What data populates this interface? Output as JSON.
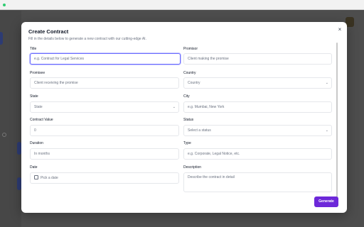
{
  "modal": {
    "title": "Create Contract",
    "subtitle": "Fill in the details below to generate a new contract with our cutting-edge AI.",
    "close_icon": "×",
    "generate_label": "Generate"
  },
  "form": {
    "title": {
      "label": "Title",
      "placeholder": "e.g. Contract for Legal Services"
    },
    "promisor": {
      "label": "Promisor",
      "placeholder": "Client making the promise"
    },
    "promisee": {
      "label": "Promisee",
      "placeholder": "Client receiving the promise"
    },
    "country": {
      "label": "Country",
      "selected": "Country"
    },
    "state": {
      "label": "State",
      "selected": "State"
    },
    "city": {
      "label": "City",
      "placeholder": "e.g. Mumbai, New York"
    },
    "contract_value": {
      "label": "Contract Value",
      "placeholder": "0"
    },
    "status": {
      "label": "Status",
      "selected": "Select a status"
    },
    "duration": {
      "label": "Duration",
      "placeholder": "In months"
    },
    "type": {
      "label": "Type",
      "placeholder": "e.g. Corporate, Legal Notice, etc."
    },
    "date": {
      "label": "Date",
      "placeholder": "Pick a date"
    },
    "description": {
      "label": "Description",
      "placeholder": "Describe the contract in detail"
    }
  },
  "icons": {
    "chevron": "chevron-down-icon",
    "calendar": "calendar-icon",
    "close": "close-icon"
  },
  "colors": {
    "accent": "#6d28d9",
    "focus_ring": "#6b6cff"
  }
}
